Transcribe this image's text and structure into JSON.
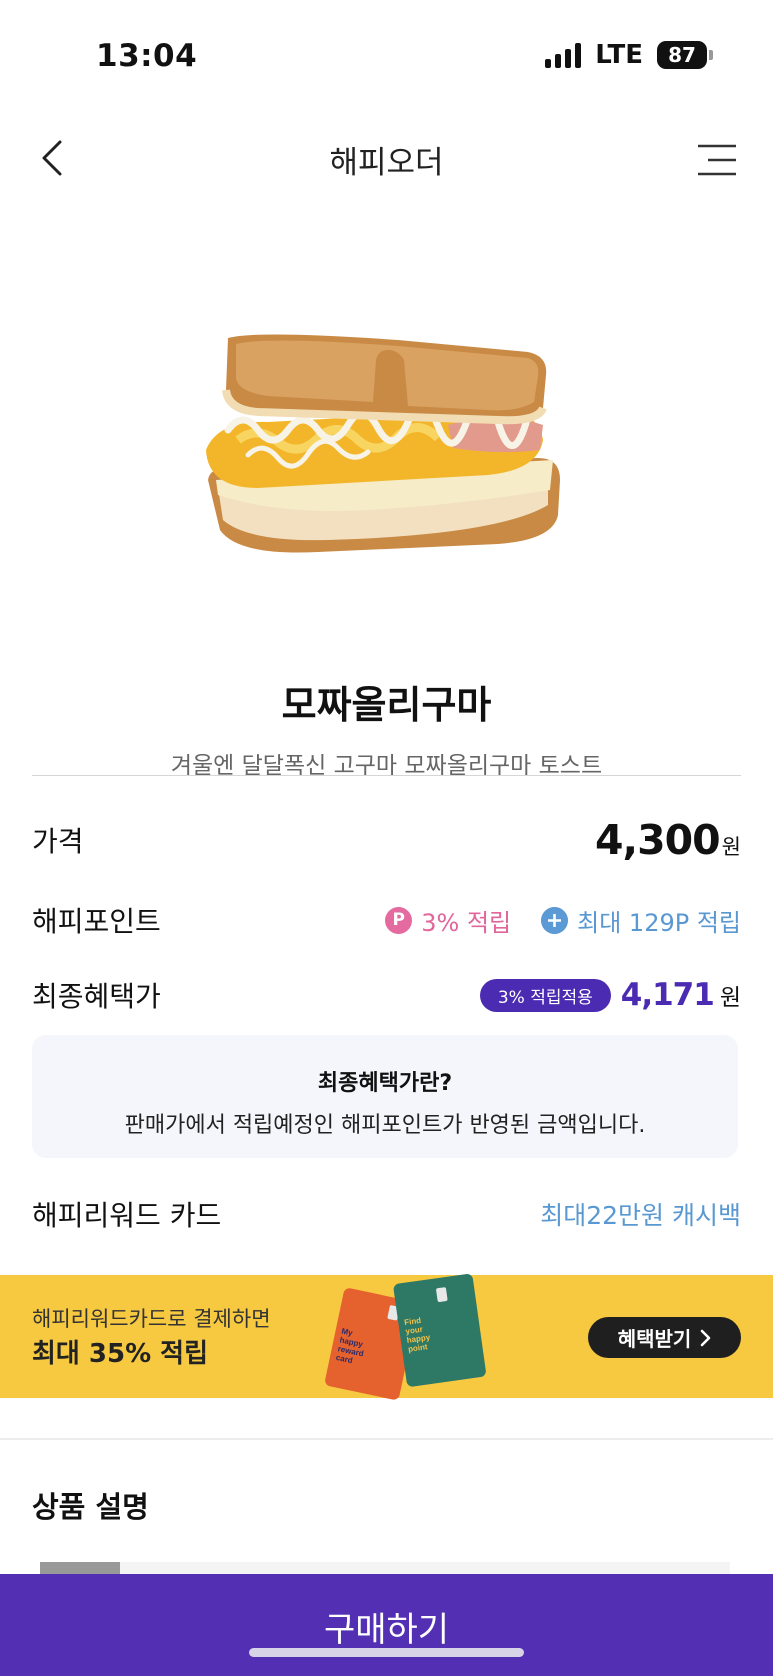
{
  "status_bar": {
    "time": "13:04",
    "network": "LTE",
    "battery": "87",
    "signal_icon": "cellular-signal-icon",
    "battery_icon": "battery-icon"
  },
  "header": {
    "title": "해피오더",
    "back_icon": "chevron-left-icon",
    "menu_icon": "hamburger-menu-icon"
  },
  "product": {
    "name": "모짜올리구마",
    "description": "겨울엔 달달폭신 고구마 모짜올리구마 토스트"
  },
  "price": {
    "label": "가격",
    "value": "4,300",
    "unit": "원"
  },
  "happy_point": {
    "label": "해피포인트",
    "icon_letter": "P",
    "rate_text": "3% 적립",
    "max_text": "최대 129P 적립"
  },
  "final_price": {
    "label": "최종혜택가",
    "badge": "3% 적립적용",
    "value": "4,171",
    "unit": "원"
  },
  "info_box": {
    "title": "최종혜택가란?",
    "body": "판매가에서 적립예정인 해피포인트가 반영된 금액입니다."
  },
  "reward_card": {
    "label": "해피리워드 카드",
    "benefit": "최대22만원 캐시백"
  },
  "banner": {
    "line1": "해피리워드카드로 결제하면",
    "line2": "최대 35% 적립",
    "button": "혜택받기",
    "cards": [
      {
        "text": "My happy reward card",
        "color": "#e5622f"
      },
      {
        "text": "Find your happy point",
        "color": "#2e7866"
      }
    ]
  },
  "section": {
    "title": "상품 설명"
  },
  "buy_button": {
    "label": "구매하기"
  },
  "colors": {
    "primary": "#5330b3",
    "point_pink": "#e0669b",
    "link_blue": "#5a98d2",
    "banner_yellow": "#f6c941"
  }
}
